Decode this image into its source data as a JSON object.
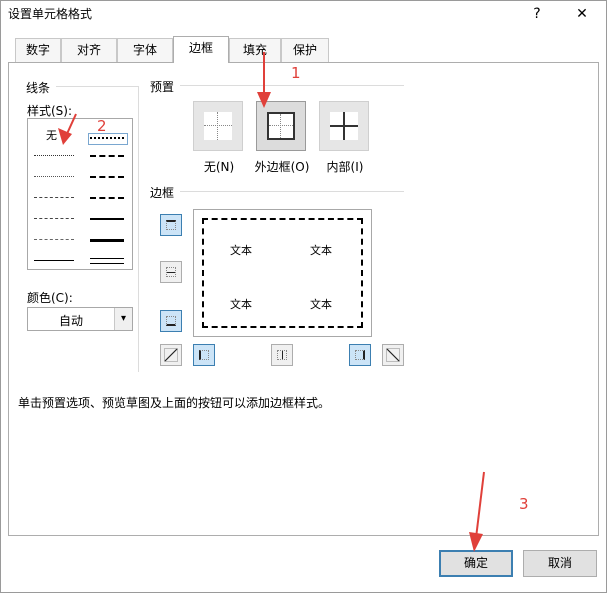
{
  "window": {
    "title": "设置单元格格式",
    "help": "?",
    "close": "✕"
  },
  "tabs": [
    {
      "label": "数字"
    },
    {
      "label": "对齐"
    },
    {
      "label": "字体"
    },
    {
      "label": "边框"
    },
    {
      "label": "填充"
    },
    {
      "label": "保护"
    }
  ],
  "active_tab": "边框",
  "line": {
    "group_title": "线条",
    "style_label": "样式(S):",
    "style_none": "无",
    "color_label": "颜色(C):",
    "color_value": "自动"
  },
  "presets": {
    "group_title": "预置",
    "items": [
      {
        "label": "无(N)"
      },
      {
        "label": "外边框(O)"
      },
      {
        "label": "内部(I)"
      }
    ]
  },
  "border": {
    "group_title": "边框",
    "preview_texts": [
      "文本",
      "文本",
      "文本",
      "文本"
    ]
  },
  "info_text": "单击预置选项、预览草图及上面的按钮可以添加边框样式。",
  "buttons": {
    "ok": "确定",
    "cancel": "取消"
  },
  "annotations": [
    "1",
    "2",
    "3"
  ],
  "colors": {
    "accent": "#3c7fb1",
    "annotation": "#e0403a",
    "selected_bg": "#cce4f7"
  }
}
